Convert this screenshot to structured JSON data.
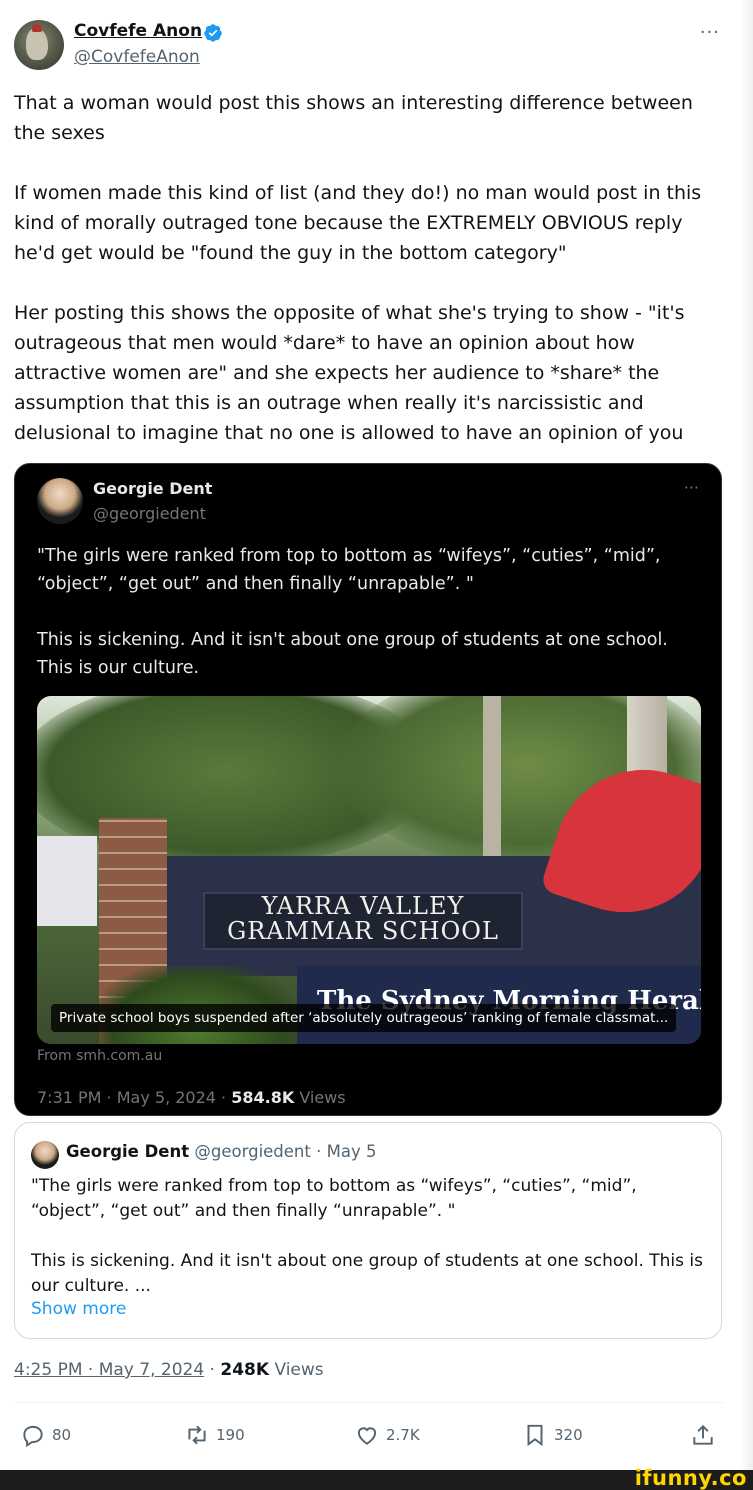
{
  "author": {
    "display_name": "Covfefe Anon",
    "handle": "@CovfefeAnon",
    "verified": true,
    "more": "···"
  },
  "tweet": {
    "paragraphs": [
      "That a woman would post this shows an interesting difference between the sexes",
      "If women made this kind of list (and they do!) no man would post in this kind of morally outraged tone because the EXTREMELY OBVIOUS reply he'd get would be \"found the guy in the bottom category\"",
      "Her posting this shows the opposite of what she's trying to show - \"it's outrageous that men would *dare* to have an opinion about how attractive women are\" and she expects her audience to *share* the assumption that this is an outrage when really it's narcissistic and delusional to imagine that no one is allowed to have an opinion of you"
    ]
  },
  "embedded_dark": {
    "display_name": "Georgie Dent",
    "handle": "@georgiedent",
    "more": "···",
    "paragraphs": [
      "\"The girls were ranked from top to bottom as “wifeys”, “cuties”, “mid”, “object”, “get out” and then finally “unrapable”. \"",
      "This is sickening. And it isn't about one group of students at one school. This is our culture."
    ],
    "image": {
      "sign_line1": "YARRA VALLEY",
      "sign_line2": "GRAMMAR SCHOOL",
      "masthead": "The Sydney Morning Herald",
      "caption": "Private school boys suspended after ‘absolutely outrageous’ ranking of female classmat..."
    },
    "source": "From smh.com.au",
    "time": "7:31 PM · May 5, 2024 · ",
    "views_count": "584.8K",
    "views_label": " Views"
  },
  "quote": {
    "display_name": "Georgie Dent",
    "handle_date": " @georgiedent · May 5",
    "paragraphs": [
      "\"The girls were ranked from top to bottom as “wifeys”, “cuties”, “mid”, “object”, “get out” and then finally “unrapable”. \"",
      "This is sickening. And it isn't about one group of students at one school. This is our culture.  ..."
    ],
    "show_more": "Show more"
  },
  "meta": {
    "timestamp": "4:25 PM · May 7, 2024",
    "separator": " · ",
    "views_count": "248K",
    "views_label": " Views"
  },
  "actions": {
    "replies": "80",
    "reposts": "190",
    "likes": "2.7K",
    "bookmarks": "320"
  },
  "watermark": "ifunny.co",
  "colors": {
    "accent": "#1d9bf0",
    "text": "#0f1419",
    "muted": "#536471",
    "dark_bg": "#000000",
    "ifunny_yellow": "#ffd600"
  }
}
